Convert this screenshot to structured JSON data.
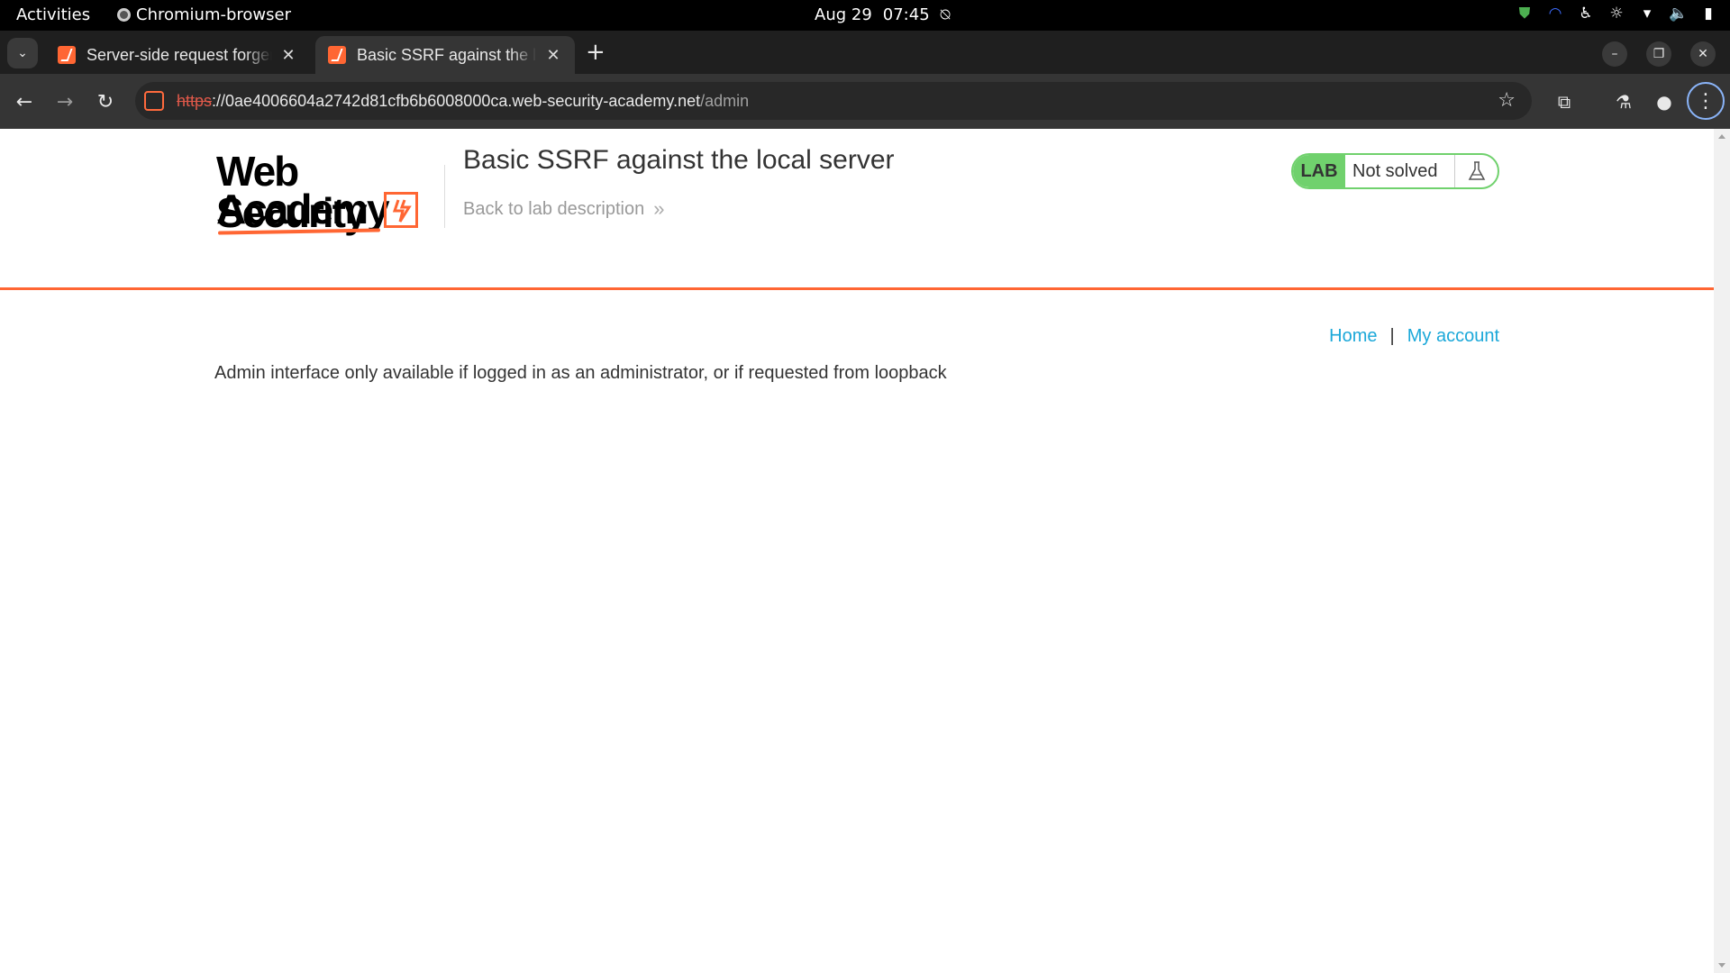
{
  "system_bar": {
    "activities": "Activities",
    "app_name": "Chromium-browser",
    "date": "Aug 29",
    "time": "07:45"
  },
  "browser": {
    "tabs": [
      {
        "title": "Server-side request forgery",
        "active": false
      },
      {
        "title": "Basic SSRF against the local server",
        "active": true
      }
    ],
    "url": {
      "scheme": "https",
      "host": "://0ae4006604a2742d81cfb6b6008000ca.web-security-academy.net",
      "path": "/admin"
    }
  },
  "page": {
    "logo": {
      "line1": "Web Security",
      "line2": "Academy"
    },
    "lab_title": "Basic SSRF against the local server",
    "back_link": "Back to lab description",
    "lab_badge": "LAB",
    "lab_status": "Not solved",
    "nav": {
      "home": "Home",
      "separator": "|",
      "account": "My account"
    },
    "message": "Admin interface only available if logged in as an administrator, or if requested from loopback"
  },
  "colors": {
    "accent_orange": "#ff6633",
    "lab_green": "#70d16d",
    "link_blue": "#1ba8d9"
  }
}
